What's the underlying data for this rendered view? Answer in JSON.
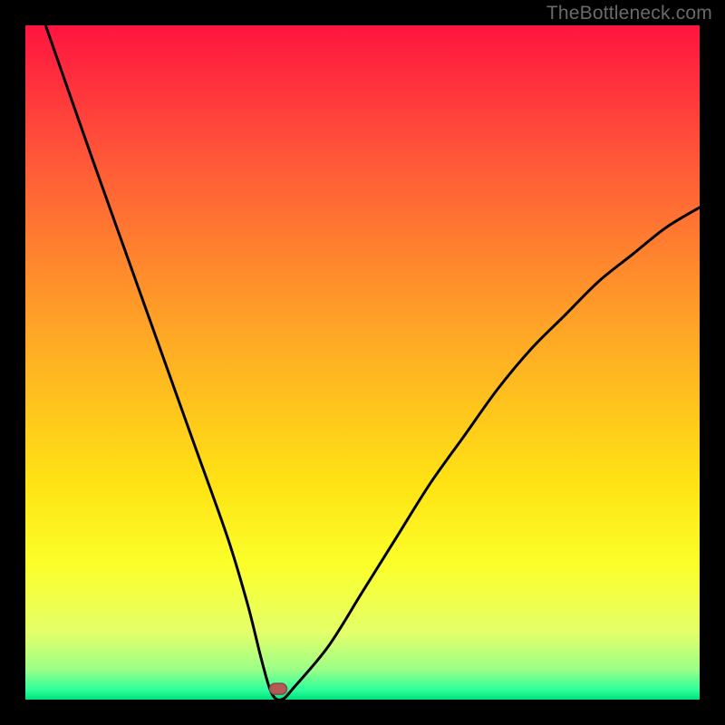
{
  "watermark": "TheBottleneck.com",
  "colors": {
    "frame": "#000000",
    "curve": "#000000",
    "marker_fill": "#b35a55",
    "marker_stroke": "#8c4844",
    "gradient_stops": [
      {
        "offset": 0.0,
        "color": "#ff1440"
      },
      {
        "offset": 0.2,
        "color": "#ff5838"
      },
      {
        "offset": 0.45,
        "color": "#ffa526"
      },
      {
        "offset": 0.68,
        "color": "#ffe314"
      },
      {
        "offset": 0.8,
        "color": "#fbff2a"
      },
      {
        "offset": 0.9,
        "color": "#e4ff68"
      },
      {
        "offset": 0.955,
        "color": "#9cff87"
      },
      {
        "offset": 0.985,
        "color": "#2fff9b"
      },
      {
        "offset": 1.0,
        "color": "#00e17e"
      }
    ]
  },
  "chart_data": {
    "type": "line",
    "title": "",
    "xlabel": "",
    "ylabel": "",
    "xlim": [
      0,
      100
    ],
    "ylim": [
      0,
      100
    ],
    "grid": false,
    "legend": false,
    "series": [
      {
        "name": "bottleneck-curve",
        "x": [
          3,
          10,
          15,
          20,
          25,
          30,
          33,
          35,
          36.5,
          38,
          40,
          45,
          50,
          55,
          60,
          65,
          70,
          75,
          80,
          85,
          90,
          95,
          100
        ],
        "values": [
          100,
          80,
          66,
          52,
          38,
          24,
          14,
          6,
          1,
          0,
          2,
          8,
          16,
          24,
          32,
          39,
          46,
          52,
          57,
          62,
          66,
          70,
          73
        ]
      }
    ],
    "annotations": [
      {
        "name": "optimal-marker",
        "x": 37.5,
        "y": 1.6,
        "shape": "rounded-rect"
      }
    ]
  }
}
